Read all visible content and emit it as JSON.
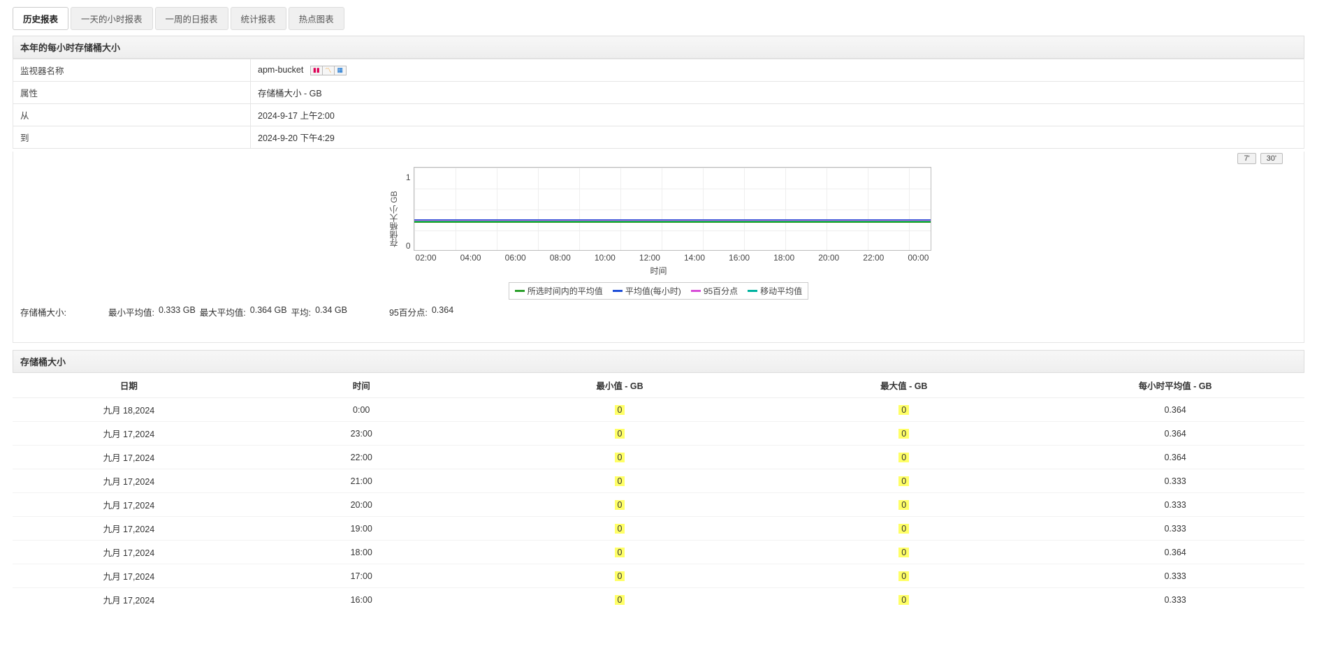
{
  "tabs": [
    "历史报表",
    "一天的小时报表",
    "一周的日报表",
    "统计报表",
    "热点图表"
  ],
  "active_tab_index": 0,
  "section_title": "本年的每小时存储桶大小",
  "info": {
    "monitor_label": "监视器名称",
    "monitor_value": "apm-bucket",
    "attr_label": "属性",
    "attr_value": "存储桶大小 - GB",
    "from_label": "从",
    "from_value": "2024-9-17 上午2:00",
    "to_label": "到",
    "to_value": "2024-9-20 下午4:29"
  },
  "chart_buttons": {
    "seven": "7'",
    "thirty": "30'"
  },
  "chart_data": {
    "type": "line",
    "ylabel": "存储桶大小 GB",
    "xlabel": "时间",
    "ylim": [
      0,
      1
    ],
    "yticks": [
      "1",
      "0"
    ],
    "categories": [
      "02:00",
      "04:00",
      "06:00",
      "08:00",
      "10:00",
      "12:00",
      "14:00",
      "16:00",
      "18:00",
      "20:00",
      "22:00",
      "00:00"
    ],
    "series": [
      {
        "name": "所选时间内的平均值",
        "color": "#2ca02c",
        "values": [
          0.34,
          0.34,
          0.34,
          0.34,
          0.34,
          0.34,
          0.34,
          0.34,
          0.34,
          0.34,
          0.34,
          0.34
        ]
      },
      {
        "name": "平均值(每小时)",
        "color": "#1f4fd8",
        "values": [
          0.36,
          0.36,
          0.36,
          0.36,
          0.36,
          0.36,
          0.36,
          0.36,
          0.36,
          0.36,
          0.36,
          0.36
        ]
      },
      {
        "name": "95百分点",
        "color": "#d84fd8",
        "values": [
          0.364,
          0.364,
          0.364,
          0.364,
          0.364,
          0.364,
          0.364,
          0.364,
          0.364,
          0.364,
          0.364,
          0.364
        ]
      },
      {
        "name": "移动平均值",
        "color": "#00b3a0",
        "values": [
          0.35,
          0.35,
          0.35,
          0.35,
          0.35,
          0.35,
          0.35,
          0.35,
          0.35,
          0.35,
          0.35,
          0.35
        ]
      }
    ]
  },
  "stats": {
    "metric_name": "存储桶大小:",
    "min_avg_label": "最小平均值:",
    "min_avg_value": "0.333  GB",
    "max_avg_label": "最大平均值:",
    "max_avg_value": "0.364  GB",
    "avg_label": "平均:",
    "avg_value": "0.34  GB",
    "p95_label": "95百分点:",
    "p95_value": "0.364"
  },
  "table_section_title": "存储桶大小",
  "table_headers": [
    "日期",
    "时间",
    "最小值 - GB",
    "最大值 - GB",
    "每小时平均值 - GB"
  ],
  "rows": [
    {
      "date": "九月 18,2024",
      "time": "0:00",
      "min": "0",
      "max": "0",
      "avg": "0.364"
    },
    {
      "date": "九月 17,2024",
      "time": "23:00",
      "min": "0",
      "max": "0",
      "avg": "0.364"
    },
    {
      "date": "九月 17,2024",
      "time": "22:00",
      "min": "0",
      "max": "0",
      "avg": "0.364"
    },
    {
      "date": "九月 17,2024",
      "time": "21:00",
      "min": "0",
      "max": "0",
      "avg": "0.333"
    },
    {
      "date": "九月 17,2024",
      "time": "20:00",
      "min": "0",
      "max": "0",
      "avg": "0.333"
    },
    {
      "date": "九月 17,2024",
      "time": "19:00",
      "min": "0",
      "max": "0",
      "avg": "0.333"
    },
    {
      "date": "九月 17,2024",
      "time": "18:00",
      "min": "0",
      "max": "0",
      "avg": "0.364"
    },
    {
      "date": "九月 17,2024",
      "time": "17:00",
      "min": "0",
      "max": "0",
      "avg": "0.333"
    },
    {
      "date": "九月 17,2024",
      "time": "16:00",
      "min": "0",
      "max": "0",
      "avg": "0.333"
    }
  ]
}
